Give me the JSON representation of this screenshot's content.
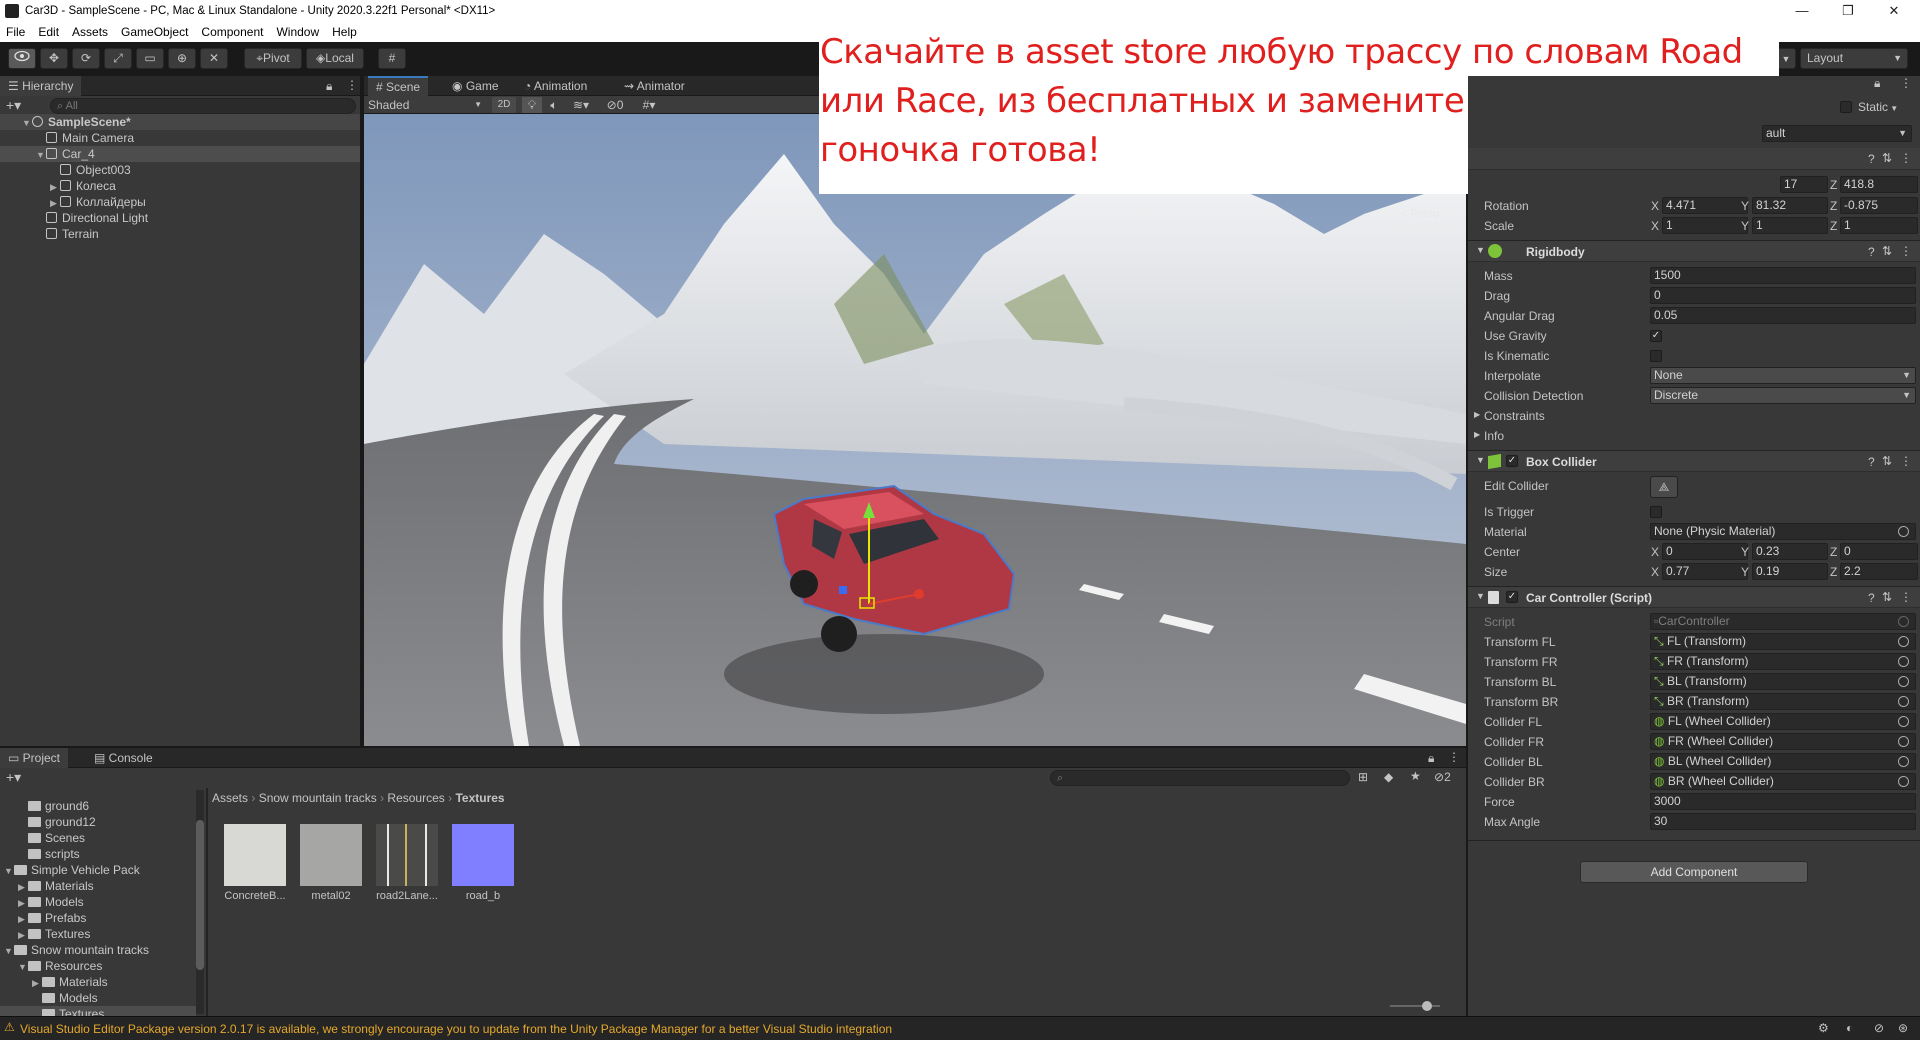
{
  "window": {
    "title": "Car3D - SampleScene - PC, Mac & Linux Standalone - Unity 2020.3.22f1 Personal* <DX11>",
    "min": "—",
    "max": "❐",
    "close": "✕"
  },
  "menu": [
    "File",
    "Edit",
    "Assets",
    "GameObject",
    "Component",
    "Window",
    "Help"
  ],
  "toolbar": {
    "pivot": "Pivot",
    "local": "Local",
    "layout": "Layout"
  },
  "hierarchy": {
    "tab": "Hierarchy",
    "search_placeholder": "All",
    "items": [
      {
        "label": "SampleScene*",
        "depth": 0,
        "kind": "scene",
        "expanded": true
      },
      {
        "label": "Main Camera",
        "depth": 1,
        "kind": "go"
      },
      {
        "label": "Car_4",
        "depth": 1,
        "kind": "go",
        "expanded": true,
        "selected": true
      },
      {
        "label": "Object003",
        "depth": 2,
        "kind": "go"
      },
      {
        "label": "Колеса",
        "depth": 2,
        "kind": "go",
        "collapsed": true
      },
      {
        "label": "Коллайдеры",
        "depth": 2,
        "kind": "go",
        "collapsed": true
      },
      {
        "label": "Directional Light",
        "depth": 1,
        "kind": "go"
      },
      {
        "label": "Terrain",
        "depth": 1,
        "kind": "go"
      }
    ]
  },
  "scene": {
    "tabs": [
      "Scene",
      "Game",
      "Animation",
      "Animator"
    ],
    "shading": "Shaded",
    "mode_2d": "2D",
    "hidden_count": "0",
    "persp": "< Persp"
  },
  "overlay_text": "Скачайте в asset store любую трассу по словам Road или Race, из бесплатных и замените terrain на сцене, гоночка готова!",
  "inspector": {
    "static": "Static",
    "layer_value": "ault",
    "transform": {
      "pos_y_partial": "17",
      "pos_z": "418.8",
      "rotation": {
        "label": "Rotation",
        "x": "4.471",
        "y": "81.32",
        "z": "-0.875"
      },
      "scale": {
        "label": "Scale",
        "x": "1",
        "y": "1",
        "z": "1"
      }
    },
    "rigidbody": {
      "title": "Rigidbody",
      "mass": {
        "label": "Mass",
        "value": "1500"
      },
      "drag": {
        "label": "Drag",
        "value": "0"
      },
      "angular_drag": {
        "label": "Angular Drag",
        "value": "0.05"
      },
      "use_gravity": {
        "label": "Use Gravity",
        "checked": true
      },
      "is_kinematic": {
        "label": "Is Kinematic",
        "checked": false
      },
      "interpolate": {
        "label": "Interpolate",
        "value": "None"
      },
      "collision_detection": {
        "label": "Collision Detection",
        "value": "Discrete"
      },
      "constraints": "Constraints",
      "info": "Info"
    },
    "box_collider": {
      "title": "Box Collider",
      "edit_collider": "Edit Collider",
      "is_trigger": "Is Trigger",
      "material": {
        "label": "Material",
        "value": "None (Physic Material)"
      },
      "center": {
        "label": "Center",
        "x": "0",
        "y": "0.23",
        "z": "0"
      },
      "size": {
        "label": "Size",
        "x": "0.77",
        "y": "0.19",
        "z": "2.2"
      }
    },
    "car_controller": {
      "title": "Car Controller (Script)",
      "script": {
        "label": "Script",
        "value": "CarController"
      },
      "fields": [
        {
          "label": "Transform FL",
          "value": "FL (Transform)"
        },
        {
          "label": "Transform FR",
          "value": "FR (Transform)"
        },
        {
          "label": "Transform BL",
          "value": "BL (Transform)"
        },
        {
          "label": "Transform BR",
          "value": "BR (Transform)"
        },
        {
          "label": "Collider FL",
          "value": "FL (Wheel Collider)"
        },
        {
          "label": "Collider FR",
          "value": "FR (Wheel Collider)"
        },
        {
          "label": "Collider BL",
          "value": "BL (Wheel Collider)"
        },
        {
          "label": "Collider BR",
          "value": "BR (Wheel Collider)"
        }
      ],
      "force": {
        "label": "Force",
        "value": "3000"
      },
      "max_angle": {
        "label": "Max Angle",
        "value": "30"
      }
    },
    "add_component": "Add Component",
    "axis_x": "X",
    "axis_y": "Y",
    "axis_z": "Z"
  },
  "project": {
    "tabs": [
      "Project",
      "Console"
    ],
    "hidden_packages": "2",
    "tree": [
      {
        "label": "ground6",
        "depth": 2
      },
      {
        "label": "ground12",
        "depth": 2
      },
      {
        "label": "Scenes",
        "depth": 2
      },
      {
        "label": "scripts",
        "depth": 2
      },
      {
        "label": "Simple Vehicle Pack",
        "depth": 1,
        "expanded": true
      },
      {
        "label": "Materials",
        "depth": 2,
        "collapsed": true
      },
      {
        "label": "Models",
        "depth": 2,
        "collapsed": true
      },
      {
        "label": "Prefabs",
        "depth": 2,
        "collapsed": true
      },
      {
        "label": "Textures",
        "depth": 2,
        "collapsed": true
      },
      {
        "label": "Snow mountain tracks",
        "depth": 1,
        "expanded": true
      },
      {
        "label": "Resources",
        "depth": 2,
        "expanded": true
      },
      {
        "label": "Materials",
        "depth": 3,
        "collapsed": true
      },
      {
        "label": "Models",
        "depth": 3
      },
      {
        "label": "Textures",
        "depth": 3,
        "selected": true
      }
    ],
    "breadcrumb": [
      "Assets",
      "Snow mountain tracks",
      "Resources",
      "Textures"
    ],
    "assets": [
      {
        "label": "ConcreteB...",
        "color": "#d8d8d4"
      },
      {
        "label": "metal02",
        "color": "#a6a6a4"
      },
      {
        "label": "road2Lane...",
        "color": "#4a4a48"
      },
      {
        "label": "road_b",
        "color": "#7f7fff"
      }
    ]
  },
  "status": "Visual Studio Editor Package version 2.0.17 is available, we strongly encourage you to update from the Unity Package Manager for a better Visual Studio integration",
  "colors": {
    "accent": "#3a79bb",
    "overlay_text": "#e0201e",
    "warning": "#e5a82b"
  }
}
